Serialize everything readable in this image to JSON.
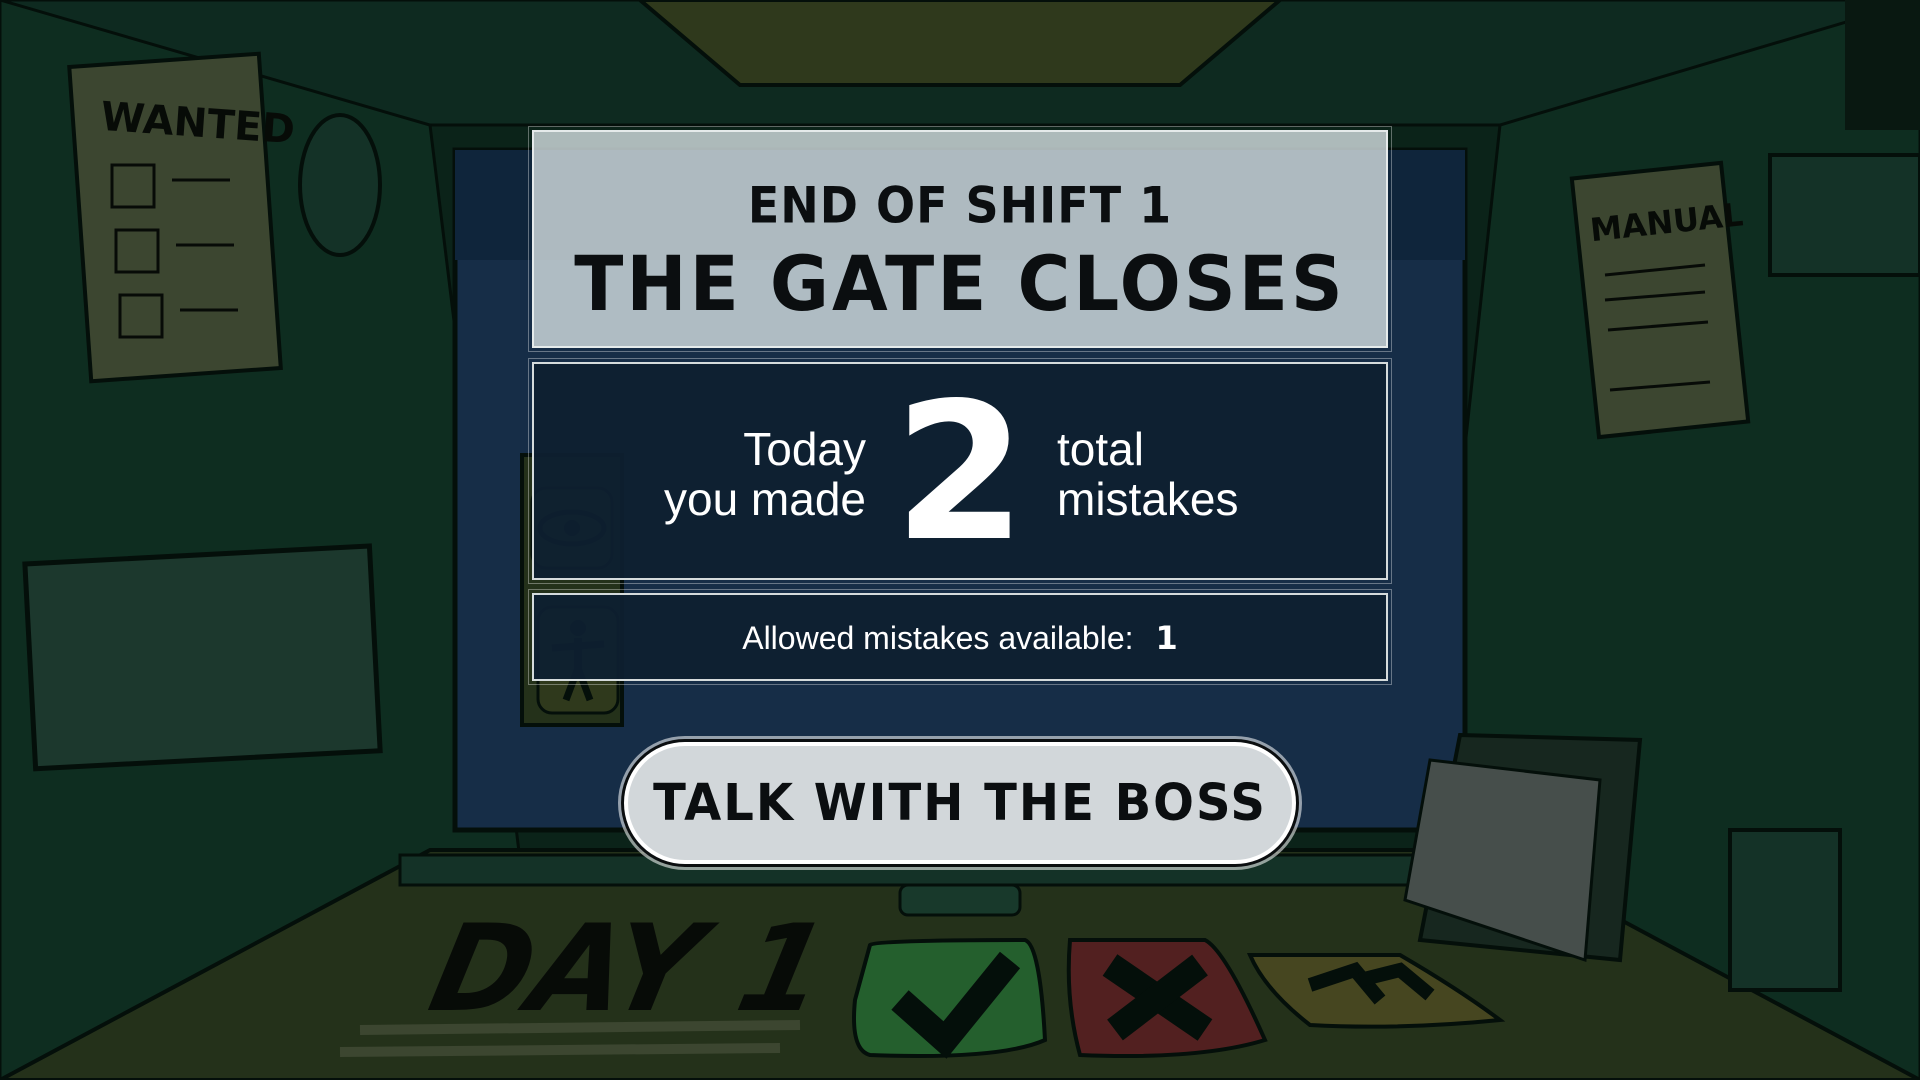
{
  "end_screen": {
    "shift_label": "END OF SHIFT 1",
    "title": "THE GATE CLOSES"
  },
  "summary": {
    "left_line_1": "Today",
    "left_line_2": "you made",
    "mistake_count": "2",
    "right_line_1": "total",
    "right_line_2": "mistakes"
  },
  "allowed": {
    "label": "Allowed mistakes available:",
    "value": "1"
  },
  "actions": {
    "boss_button_label": "TALK WITH THE BOSS"
  },
  "background": {
    "wanted_poster_text": "WANTED",
    "manual_text": "MANUAL",
    "day_label": "DAY 1",
    "approve_icon": "checkmark-icon",
    "deny_icon": "x-icon",
    "skip_icon": "fast-forward-icon",
    "eye_icon": "eye-icon",
    "person_icon": "person-icon",
    "colors": {
      "wall_dark": "#0d2a1e",
      "wall_mid": "#1c4a34",
      "window_blue": "#1d3a5c",
      "approve_green": "#2f7a3a",
      "deny_red": "#6a2a2a",
      "skip_yellow": "#5a5a2a",
      "panel_navy": "#0e2030"
    }
  }
}
